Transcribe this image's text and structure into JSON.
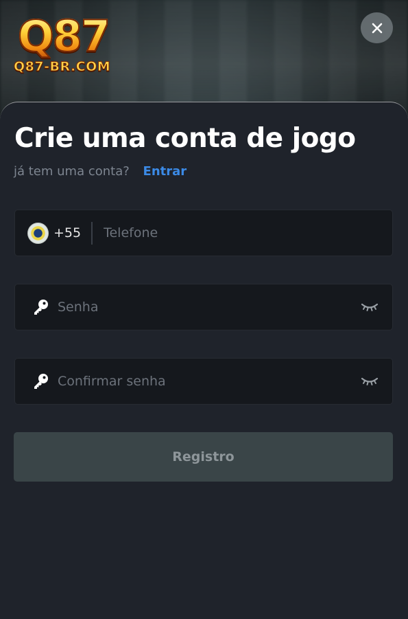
{
  "logo": {
    "main_text": "Q87",
    "sub_text": "Q87-BR.COM"
  },
  "close": {
    "icon": "close-icon"
  },
  "form": {
    "title": "Crie uma conta de jogo",
    "login_prompt": "já tem uma conta?",
    "login_link": "Entrar",
    "phone": {
      "flag_icon": "brazil-flag-icon",
      "country_code": "+55",
      "placeholder": "Telefone",
      "value": ""
    },
    "password": {
      "icon": "key-icon",
      "placeholder": "Senha",
      "value": "",
      "toggle_icon": "eye-closed-icon"
    },
    "confirm_password": {
      "icon": "key-icon",
      "placeholder": "Confirmar senha",
      "value": "",
      "toggle_icon": "eye-closed-icon"
    },
    "submit_label": "Registro"
  },
  "colors": {
    "accent_link": "#3b8ae6",
    "sheet_background": "#1f232b",
    "input_background": "#15181d",
    "button_disabled": "#3a4548",
    "logo_gold": "#ffd23a"
  }
}
